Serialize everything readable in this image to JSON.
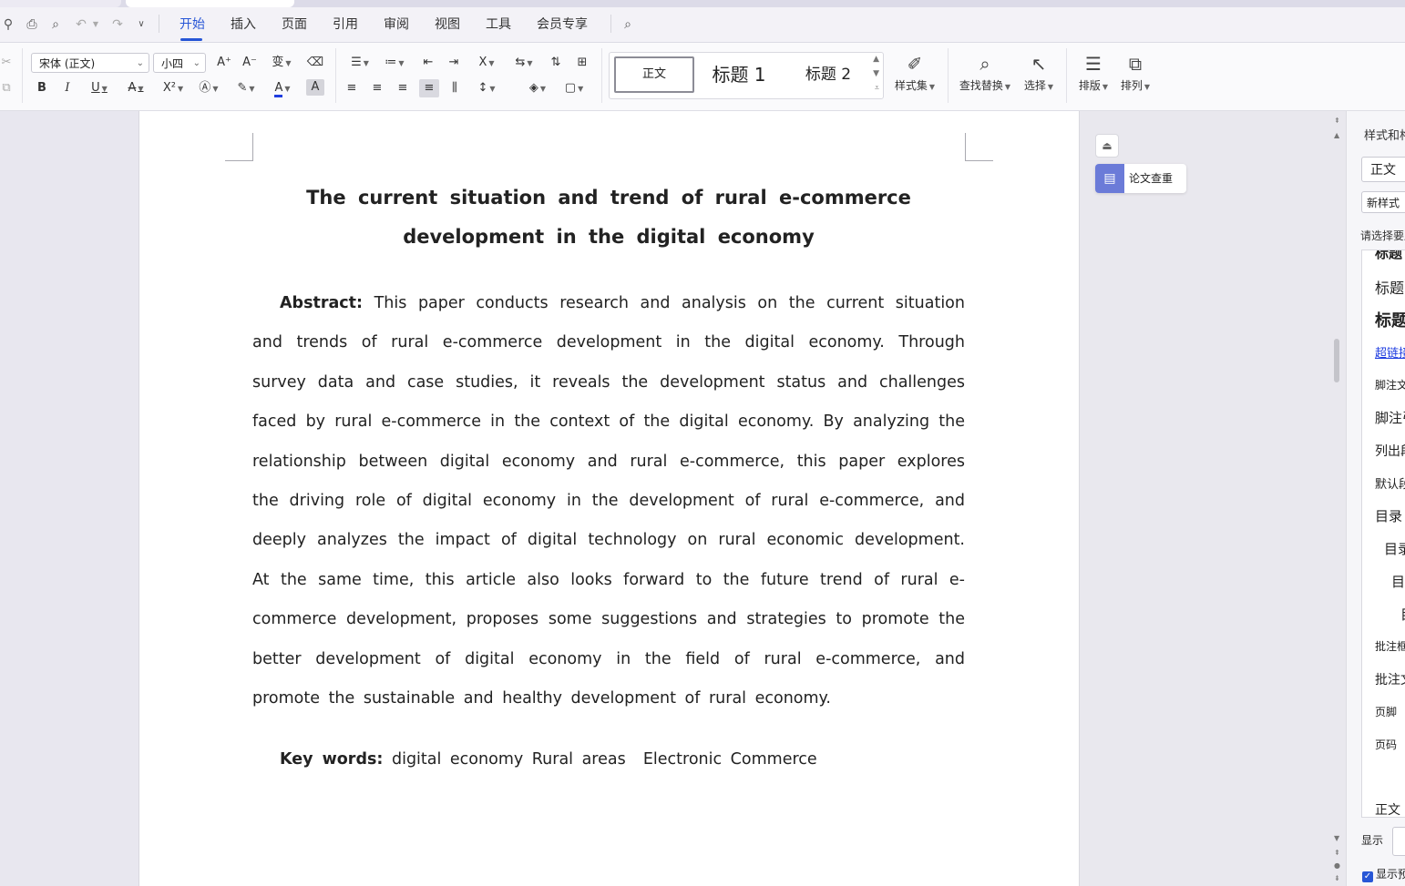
{
  "menu": {
    "tabs": [
      "开始",
      "插入",
      "页面",
      "引用",
      "审阅",
      "视图",
      "工具",
      "会员专享"
    ],
    "active_tab": "开始"
  },
  "ribbon": {
    "font_name": "宋体 (正文)",
    "font_size": "小四",
    "styles": {
      "normal": "正文",
      "heading1": "标题  1",
      "heading2": "标题  2"
    },
    "style_set_label": "样式集",
    "find_replace_label": "查找替换",
    "select_label": "选择",
    "layout_label": "排版",
    "arrange_label": "排列"
  },
  "document": {
    "title": "The current situation and trend of rural e-commerce development in the digital economy",
    "abstract_label": "Abstract:",
    "abstract_text": "This paper conducts research and analysis on the current situation and trends of rural e-commerce development in the digital economy. Through survey data and case studies, it reveals the development status and challenges faced by rural e-commerce in the context of the digital economy. By analyzing the relationship between digital economy and rural e-commerce, this paper explores the driving role of digital economy in the development of rural e-commerce, and deeply analyzes the impact of digital technology on rural economic development. At the same time, this article also looks forward to the future trend of rural e-commerce development, proposes some suggestions and strategies to promote the better development of digital economy in the field of rural e-commerce, and promote the sustainable and healthy development of rural economy.",
    "keywords_label": "Key words:",
    "keywords_text": "digital economy Rural areas  Electronic Commerce"
  },
  "floating": {
    "plagiarism_check": "论文查重"
  },
  "style_panel": {
    "title": "样式和格式",
    "current_style": "正文",
    "new_style_button": "新样式",
    "prompt": "请选择要应用的格式",
    "items": [
      "标题",
      "标题",
      "标题",
      "超链接",
      "脚注文本",
      "脚注引用",
      "列出段落",
      "默认段落字体",
      "目录",
      "目录",
      "目录",
      "目录",
      "批注框文本",
      "批注文字",
      "页脚",
      "页码",
      "正文"
    ],
    "show_label": "显示",
    "show_preview_label": "显示预览"
  }
}
